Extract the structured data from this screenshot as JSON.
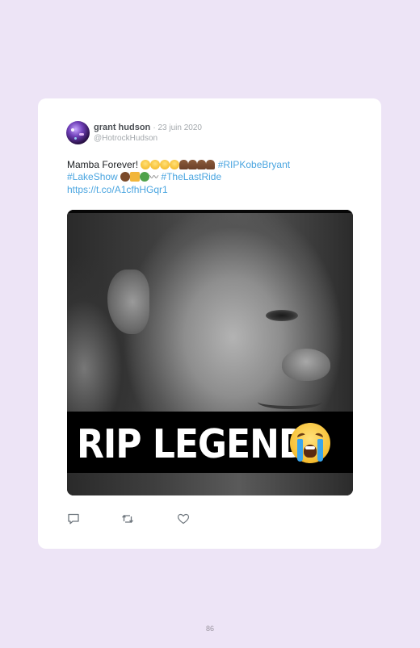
{
  "tweet": {
    "display_name": "grant hudson",
    "date": "· 23 juin 2020",
    "handle": "@HotrockHudson",
    "text": {
      "intro": "Mamba Forever! ",
      "hashtag1": "#RIPKobeBryant",
      "hashtag2": "#LakeShow",
      "hashtag3": "#TheLastRide",
      "link": "https://t.co/A1cfhHGqr1"
    },
    "emoji": {
      "faces": [
        "smiling-face",
        "smiling-face",
        "smiling-face",
        "smiling-face"
      ],
      "hands": [
        "folded-hands",
        "folded-hands",
        "folded-hands",
        "folded-hands"
      ],
      "after_lakeshow": [
        "person-head",
        "crown",
        "snake",
        "wavy-dash"
      ]
    },
    "media": {
      "caption": "RIP LEGEND",
      "caption_emoji": "loudly-crying-face"
    }
  },
  "actions": {
    "reply_icon": "reply-icon",
    "retweet_icon": "retweet-icon",
    "like_icon": "heart-icon"
  },
  "page": {
    "number": "86"
  },
  "colors": {
    "background": "#ede4f6",
    "card": "#ffffff",
    "link": "#4aa5e0",
    "muted": "#a4a9ad"
  }
}
